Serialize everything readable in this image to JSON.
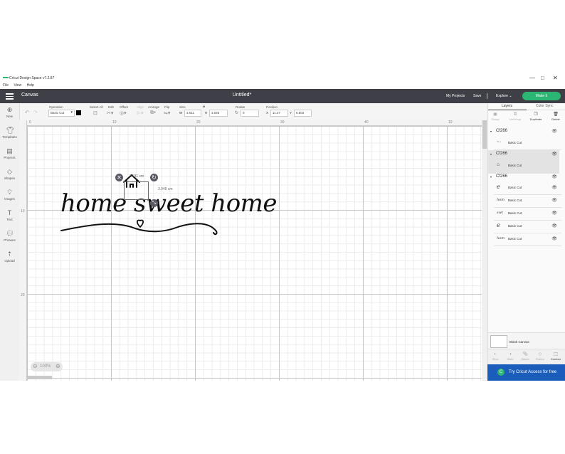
{
  "window": {
    "title": "Cricut Design Space  v7.2.87",
    "controls": [
      "—",
      "□",
      "✕"
    ]
  },
  "menu": [
    "File",
    "View",
    "Help"
  ],
  "header": {
    "section": "Canvas",
    "doc_title": "Untitled*",
    "my_projects": "My Projects",
    "save": "Save",
    "explore": "Explore",
    "make_it": "Make It"
  },
  "toolbar": {
    "operation_label": "Operation",
    "operation_value": "Basic Cut",
    "select_all": "Select All",
    "edit": "Edit",
    "offset": "Offset",
    "align": "Align",
    "arrange": "Arrange",
    "flip": "Flip",
    "size": "Size",
    "size_w_label": "W",
    "size_w": "3.011",
    "size_h_label": "H",
    "size_h": "3.045",
    "rotate": "Rotate",
    "rotate_value": "0",
    "position": "Position",
    "pos_x_label": "X",
    "pos_x": "11.47",
    "pos_y_label": "Y",
    "pos_y": "6.802"
  },
  "sidebar": [
    {
      "label": "New",
      "icon": "plus-circle-icon"
    },
    {
      "label": "Templates",
      "icon": "shirt-icon"
    },
    {
      "label": "Projects",
      "icon": "projects-icon"
    },
    {
      "label": "Shapes",
      "icon": "shapes-icon"
    },
    {
      "label": "Images",
      "icon": "lightbulb-icon"
    },
    {
      "label": "Text",
      "icon": "text-icon"
    },
    {
      "label": "Phrases",
      "icon": "speech-bubble-icon"
    },
    {
      "label": "Upload",
      "icon": "upload-icon"
    }
  ],
  "rulers": {
    "top": [
      "0",
      "10",
      "20",
      "30",
      "40",
      "50",
      "10"
    ],
    "left": [
      "10",
      "20"
    ]
  },
  "canvas": {
    "text": "home sweet home",
    "width_label": "3.011 cm",
    "height_label": "3.045 cm",
    "zoom": "100%"
  },
  "right_panel": {
    "tabs": [
      "Layers",
      "Color Sync"
    ],
    "actions": [
      "Group",
      "UnGroup",
      "Duplicate",
      "Delete"
    ],
    "groups": [
      {
        "name": "Cf266",
        "layers": [
          {
            "name": "Basic Cut",
            "thumb": "~·-"
          }
        ]
      },
      {
        "name": "Cf266",
        "layers": [
          {
            "name": "Basic Cut",
            "thumb": "⌂"
          }
        ]
      },
      {
        "name": "Cf266",
        "layers": [
          {
            "name": "Basic Cut",
            "thumb": "e"
          },
          {
            "name": "Basic Cut",
            "thumb": "hom"
          },
          {
            "name": "Basic Cut",
            "thumb": "swt"
          },
          {
            "name": "Basic Cut",
            "thumb": "e"
          },
          {
            "name": "Basic Cut",
            "thumb": "hom"
          }
        ]
      }
    ],
    "blank_canvas": "Blank Canvas",
    "bottom_actions": [
      "Slice",
      "Weld",
      "Attach",
      "Flatten",
      "Contour"
    ],
    "cta": "Try Cricut Access for free"
  },
  "colors": {
    "header_bg": "#3f3f47",
    "make_it": "#2bb673",
    "cta_bg": "#1a5dbb",
    "selected_group": "#e3e3e3"
  }
}
